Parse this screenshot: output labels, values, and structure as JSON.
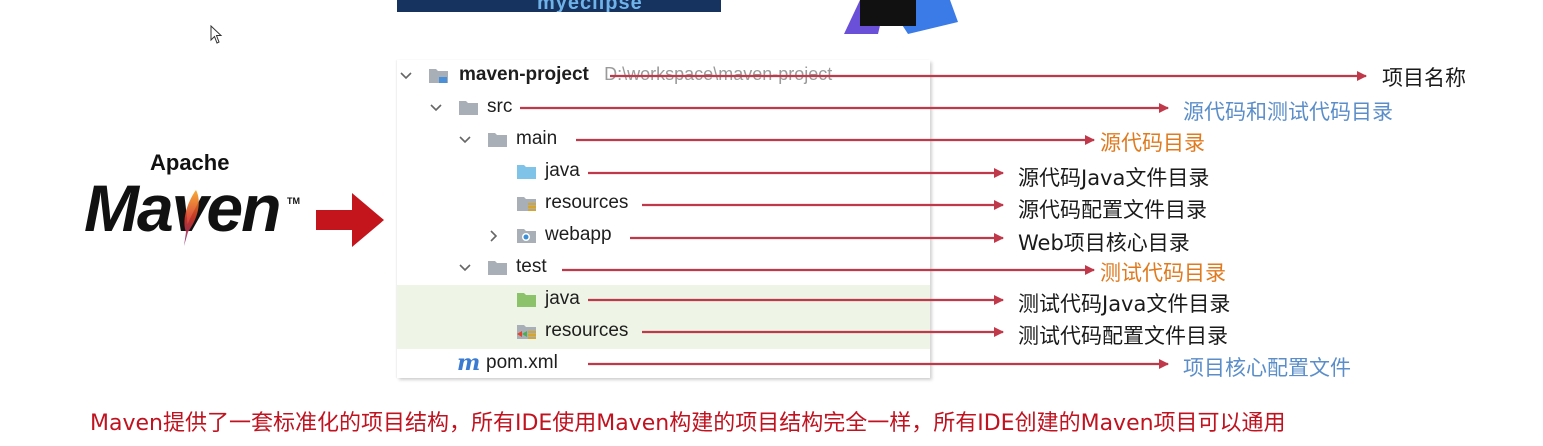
{
  "top_logos": {
    "eclipse_text": "myeclipse"
  },
  "maven_logo": {
    "apache": "Apache",
    "maven": "Maven",
    "tm": "TM"
  },
  "tree": {
    "root": {
      "name": "maven-project",
      "path": "D:\\workspace\\maven-project"
    },
    "src": "src",
    "main": "main",
    "main_java": "java",
    "main_resources": "resources",
    "webapp": "webapp",
    "test": "test",
    "test_java": "java",
    "test_resources": "resources",
    "pom": "pom.xml"
  },
  "annotations": {
    "root": "项目名称",
    "src": "源代码和测试代码目录",
    "main": "源代码目录",
    "main_java": "源代码Java文件目录",
    "main_resources": "源代码配置文件目录",
    "webapp": "Web项目核心目录",
    "test": "测试代码目录",
    "test_java": "测试代码Java文件目录",
    "test_resources": "测试代码配置文件目录",
    "pom": "项目核心配置文件"
  },
  "caption": "Maven提供了一套标准化的项目结构，所有IDE使用Maven构建的项目结构完全一样，所有IDE创建的Maven项目可以通用",
  "colors": {
    "arrow": "#c0394a",
    "annotation_black": "#1a1a1a",
    "annotation_blue": "#5b8ec9",
    "annotation_orange": "#e07a1f",
    "caption": "#c0121f",
    "test_highlight": "#eef5e6"
  }
}
